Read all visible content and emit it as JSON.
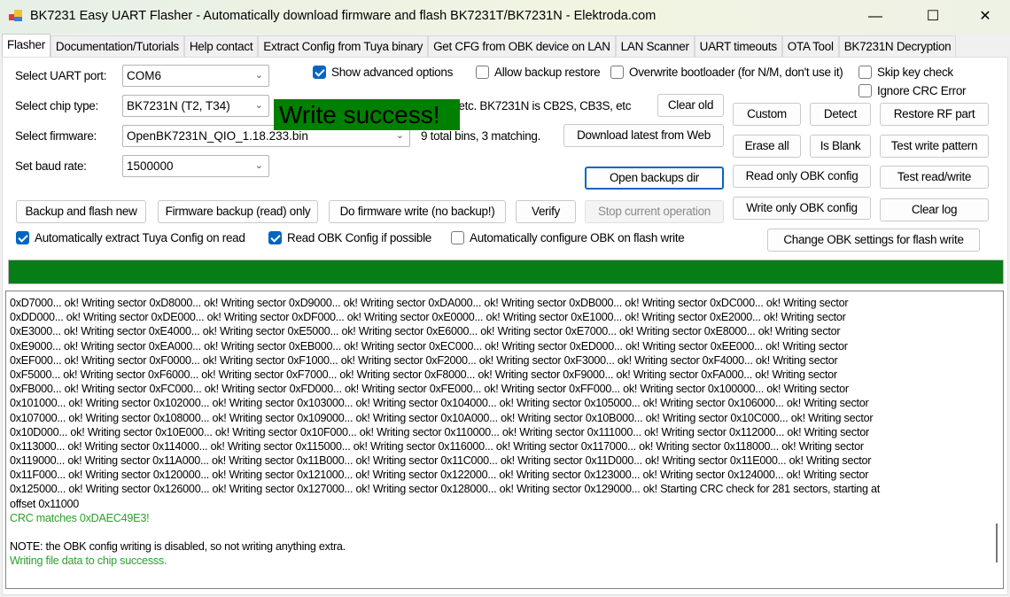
{
  "window": {
    "title": "BK7231 Easy UART Flasher - Automatically download firmware and flash BK7231T/BK7231N  - Elektroda.com",
    "minimize": "—",
    "maximize": "☐",
    "close": "✕"
  },
  "tabs": [
    "Flasher",
    "Documentation/Tutorials",
    "Help contact",
    "Extract Config from Tuya binary",
    "Get CFG from OBK device on LAN",
    "LAN Scanner",
    "UART timeouts",
    "OTA Tool",
    "BK7231N Decryption"
  ],
  "form": {
    "uart_label": "Select UART port:",
    "uart_value": "COM6",
    "chip_label": "Select chip type:",
    "chip_value": "BK7231N (T2, T34)",
    "chip_info": "BK7231T is WB3S, WB2S, WB2L, etc. BK7231N is CB2S, CB3S, etc",
    "firmware_label": "Select firmware:",
    "firmware_value": "OpenBK7231N_QIO_1.18.233.bin",
    "firmware_info": "9 total bins, 3 matching.",
    "baud_label": "Set baud rate:",
    "baud_value": "1500000",
    "status": "Write success!"
  },
  "checkboxes": {
    "show_advanced": {
      "label": "Show advanced options",
      "checked": true
    },
    "allow_backup_restore": {
      "label": "Allow backup restore",
      "checked": false
    },
    "overwrite_bootloader": {
      "label": "Overwrite bootloader (for N/M, don't use it)",
      "checked": false
    },
    "skip_key_check": {
      "label": "Skip key check",
      "checked": false
    },
    "ignore_crc": {
      "label": "Ignore CRC Error",
      "checked": false
    },
    "auto_extract_tuya": {
      "label": "Automatically extract Tuya Config on read",
      "checked": true
    },
    "read_obk_config": {
      "label": "Read OBK Config if possible",
      "checked": true
    },
    "auto_configure_obk": {
      "label": "Automatically configure OBK on flash write",
      "checked": false
    }
  },
  "buttons": {
    "clear_old": "Clear old",
    "download_latest": "Download latest from Web",
    "open_backups": "Open backups dir",
    "custom": "Custom",
    "detect": "Detect",
    "restore_rf": "Restore RF part",
    "erase_all": "Erase all",
    "is_blank": "Is Blank",
    "test_write_pattern": "Test write pattern",
    "read_only_obk": "Read only OBK config",
    "test_read_write": "Test read/write",
    "write_only_obk": "Write only OBK config",
    "clear_log": "Clear log",
    "backup_and_flash": "Backup and flash new",
    "firmware_backup": "Firmware backup (read) only",
    "firmware_write": "Do firmware write (no backup!)",
    "verify": "Verify",
    "stop": "Stop current operation",
    "change_obk_settings": "Change OBK settings for flash write"
  },
  "progress": {
    "percent": 100
  },
  "log": {
    "lines": [
      "0xD7000... ok! Writing sector 0xD8000... ok! Writing sector 0xD9000... ok! Writing sector 0xDA000... ok! Writing sector 0xDB000... ok! Writing sector 0xDC000... ok! Writing sector",
      "0xDD000... ok! Writing sector 0xDE000... ok! Writing sector 0xDF000... ok! Writing sector 0xE0000... ok! Writing sector 0xE1000... ok! Writing sector 0xE2000... ok! Writing sector",
      "0xE3000... ok! Writing sector 0xE4000... ok! Writing sector 0xE5000... ok! Writing sector 0xE6000... ok! Writing sector 0xE7000... ok! Writing sector 0xE8000... ok! Writing sector",
      "0xE9000... ok! Writing sector 0xEA000... ok! Writing sector 0xEB000... ok! Writing sector 0xEC000... ok! Writing sector 0xED000... ok! Writing sector 0xEE000... ok! Writing sector",
      "0xEF000... ok! Writing sector 0xF0000... ok! Writing sector 0xF1000... ok! Writing sector 0xF2000... ok! Writing sector 0xF3000... ok! Writing sector 0xF4000... ok! Writing sector",
      "0xF5000... ok! Writing sector 0xF6000... ok! Writing sector 0xF7000... ok! Writing sector 0xF8000... ok! Writing sector 0xF9000... ok! Writing sector 0xFA000... ok! Writing sector",
      "0xFB000... ok! Writing sector 0xFC000... ok! Writing sector 0xFD000... ok! Writing sector 0xFE000... ok! Writing sector 0xFF000... ok! Writing sector 0x100000... ok! Writing sector",
      "0x101000... ok! Writing sector 0x102000... ok! Writing sector 0x103000... ok! Writing sector 0x104000... ok! Writing sector 0x105000... ok! Writing sector 0x106000... ok! Writing sector",
      "0x107000... ok! Writing sector 0x108000... ok! Writing sector 0x109000... ok! Writing sector 0x10A000... ok! Writing sector 0x10B000... ok! Writing sector 0x10C000... ok! Writing sector",
      "0x10D000... ok! Writing sector 0x10E000... ok! Writing sector 0x10F000... ok! Writing sector 0x110000... ok! Writing sector 0x111000... ok! Writing sector 0x112000... ok! Writing sector",
      "0x113000... ok! Writing sector 0x114000... ok! Writing sector 0x115000... ok! Writing sector 0x116000... ok! Writing sector 0x117000... ok! Writing sector 0x118000... ok! Writing sector",
      "0x119000... ok! Writing sector 0x11A000... ok! Writing sector 0x11B000... ok! Writing sector 0x11C000... ok! Writing sector 0x11D000... ok! Writing sector 0x11E000... ok! Writing sector",
      "0x11F000... ok! Writing sector 0x120000... ok! Writing sector 0x121000... ok! Writing sector 0x122000... ok! Writing sector 0x123000... ok! Writing sector 0x124000... ok! Writing sector",
      "0x125000... ok! Writing sector 0x126000... ok! Writing sector 0x127000... ok! Writing sector 0x128000... ok! Writing sector 0x129000... ok! Starting CRC check for 281 sectors, starting at",
      "offset 0x11000"
    ],
    "crc": "CRC matches 0xDAEC49E3!",
    "note": "NOTE: the OBK config writing is disabled, so not writing anything extra.",
    "result": "Writing file data to chip successs."
  }
}
